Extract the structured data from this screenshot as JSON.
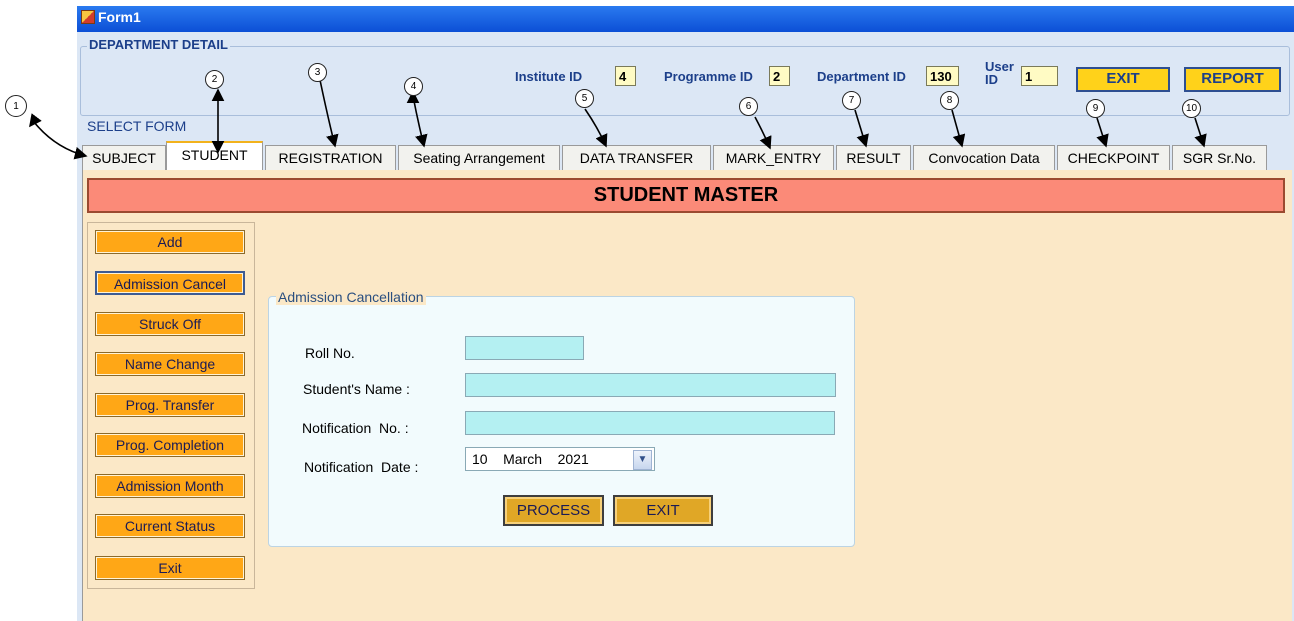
{
  "window": {
    "title": "Form1"
  },
  "department": {
    "legend": "DEPARTMENT DETAIL",
    "institute_label": "Institute ID",
    "institute_value": "4",
    "programme_label": "Programme ID",
    "programme_value": "2",
    "department_label": "Department ID",
    "department_value": "130",
    "user_label": "User ID",
    "user_value": "1",
    "exit_label": "EXIT",
    "report_label": "REPORT"
  },
  "select_form_label": "SELECT FORM",
  "tabs": [
    "SUBJECT",
    "STUDENT",
    "REGISTRATION",
    "Seating Arrangement",
    "DATA TRANSFER",
    "MARK_ENTRY",
    "RESULT",
    "Convocation Data",
    "CHECKPOINT",
    "SGR Sr.No."
  ],
  "active_tab": "STUDENT",
  "page_title": "STUDENT MASTER",
  "side_buttons": [
    "Add",
    "Admission Cancel",
    "Struck Off",
    "Name Change",
    "Prog. Transfer",
    "Prog. Completion",
    "Admission Month",
    "Current Status",
    "Exit"
  ],
  "cancellation": {
    "legend": "Admission Cancellation",
    "roll_label": "Roll No.",
    "name_label": "Student's Name :",
    "notification_label": "Notification  No. :",
    "date_label": "Notification  Date :",
    "date_value": "10    March    2021",
    "process_label": "PROCESS",
    "exit_label": "EXIT"
  },
  "callouts": [
    "1",
    "2",
    "3",
    "4",
    "5",
    "6",
    "7",
    "8",
    "9",
    "10"
  ],
  "colors": {
    "titlebar": "#0c4fd6",
    "header_bar": "#fb8a78",
    "side_button": "#ffa716",
    "top_button": "#ffd21a",
    "input_fill": "#b4f0f2"
  }
}
